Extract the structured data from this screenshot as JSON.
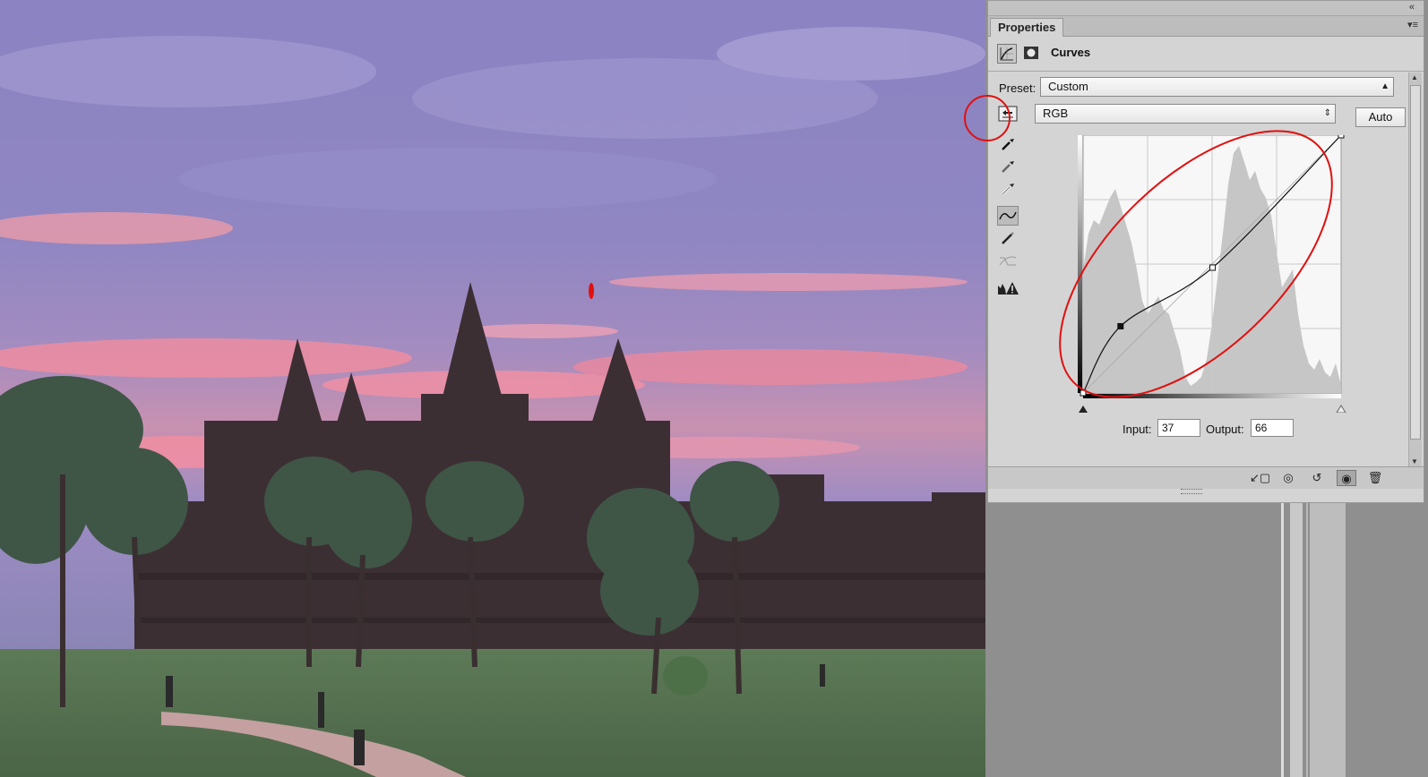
{
  "panel": {
    "tab_label": "Properties",
    "title": "Curves",
    "preset_label": "Preset:",
    "preset_value": "Custom",
    "channel_value": "RGB",
    "auto_label": "Auto",
    "input_label": "Input:",
    "input_value": "37",
    "output_label": "Output:",
    "output_value": "66",
    "collapse_icon": "double-chevron-icon",
    "menu_icon": "panel-menu-icon"
  },
  "tools": [
    {
      "name": "on-image-adjust-tool",
      "icon": "hand-adjust-icon",
      "active": false
    },
    {
      "name": "black-point-eyedropper",
      "icon": "eyedropper-icon",
      "active": false
    },
    {
      "name": "gray-point-eyedropper",
      "icon": "eyedropper-icon",
      "active": false
    },
    {
      "name": "white-point-eyedropper",
      "icon": "eyedropper-icon",
      "active": false
    },
    {
      "name": "curve-points-tool",
      "icon": "curve-icon",
      "active": true
    },
    {
      "name": "pencil-draw-tool",
      "icon": "pencil-icon",
      "active": false
    },
    {
      "name": "smooth-curve-tool",
      "icon": "smooth-icon",
      "active": false
    },
    {
      "name": "clipping-warning-tool",
      "icon": "clipping-warning-icon",
      "active": false
    }
  ],
  "curve": {
    "points": [
      [
        0,
        0
      ],
      [
        37,
        66
      ],
      [
        128,
        124
      ],
      [
        255,
        255
      ]
    ]
  },
  "bottom_icons": [
    "clip-to-layer-icon",
    "view-previous-icon",
    "reset-icon",
    "visibility-eye-icon",
    "trash-icon"
  ],
  "colors": {
    "annotation_red": "#e01010",
    "panel_bg": "#d4d4d4",
    "sky_purple": "#8a80c0",
    "sunset_pink": "#e7839a"
  }
}
